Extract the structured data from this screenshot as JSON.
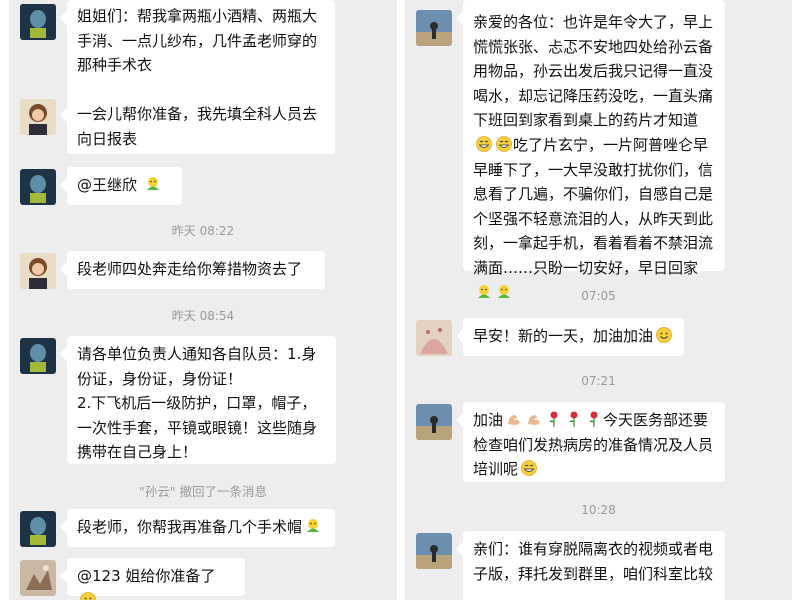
{
  "left": {
    "messages": [
      {
        "text": "姐姐们：帮我拿两瓶小酒精、两瓶大手消、一点儿纱布，几件孟老师穿的那种手术衣"
      },
      {
        "text": "一会儿帮你准备，我先填全科人员去向日报表"
      },
      {
        "text": "@王继欣 ",
        "emoji": "leaf-emoji-icon"
      },
      {
        "text": "段老师四处奔走给你筹措物资去了"
      },
      {
        "text": "请各单位负责人通知各自队员：1.身份证，身份证，身份证！\n2.下飞机后一级防护，口罩，帽子，一次性手套，平镜或眼镜！这些随身携带在自己身上！"
      },
      {
        "text": "段老师，你帮我再准备几个手术帽",
        "emoji": "leaf-emoji-icon"
      },
      {
        "text": "@123 姐给你准备了",
        "emoji": "smile-emoji-icon"
      }
    ],
    "times": [
      "昨天 08:22",
      "昨天 08:54"
    ],
    "recall_notice": "\"孙云\" 撤回了一条消息"
  },
  "right": {
    "messages": [
      {
        "text": "亲爱的各位：也许是年令大了，早上慌慌张张、忐忑不安地四处给孙云备用物品，孙云出发后我只记得一直没喝水，却忘记降压药没吃，一直头痛下班回到家看到桌上的药片才知道",
        "emoji": "grin-emoji-icon",
        "text2": "吃了片玄宁，一片阿普唑仑早早睡下了，一大早没敢打扰你们，信息看了几遍，不骗你们，自感自己是个坚强不轻意流泪的人，从昨天到此刻，一拿起手机，看着看着不禁泪流满面……只盼一切安好，早日回家"
      },
      {
        "text": "早安！新的一天，加油加油",
        "emoji": "smile-emoji-icon"
      },
      {
        "text": "加油",
        "text2": "今天医务部还要检查咱们发热病房的准备情况及人员培训呢"
      },
      {
        "text": "亲们：谁有穿脱隔离衣的视频或者电子版，拜托发到群里，咱们科室比较"
      }
    ],
    "times": [
      "07:05",
      "07:21",
      "10:28"
    ]
  },
  "colors": {
    "pane_bg": "#ededed",
    "bubble_bg": "#ffffff",
    "timestamp": "#9a9a9a"
  }
}
